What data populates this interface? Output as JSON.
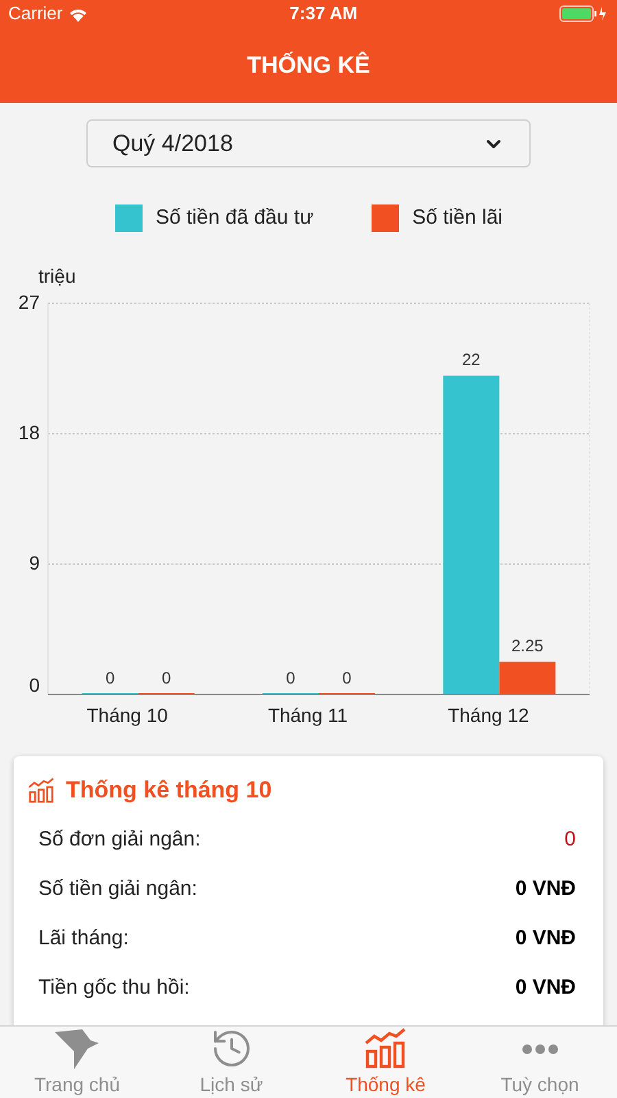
{
  "status_bar": {
    "carrier": "Carrier",
    "time": "7:37 AM"
  },
  "header": {
    "title": "THỐNG KÊ"
  },
  "period_select": {
    "value": "Quý 4/2018"
  },
  "chart_data": {
    "type": "bar",
    "ylabel": "triệu",
    "categories": [
      "Tháng 10",
      "Tháng 11",
      "Tháng 12"
    ],
    "series": [
      {
        "name": "Số tiền đã đầu tư",
        "color": "#35c3d0",
        "values": [
          0,
          0,
          22
        ]
      },
      {
        "name": "Số tiền lãi",
        "color": "#f05022",
        "values": [
          0,
          0,
          2.25
        ]
      }
    ],
    "ylim": [
      0,
      27
    ],
    "yticks": [
      0,
      9,
      18,
      27
    ],
    "data_labels": true
  },
  "summary": {
    "title": "Thống kê tháng 10",
    "rows": [
      {
        "label": "Số đơn giải ngân:",
        "value": "0",
        "kind": "count"
      },
      {
        "label": "Số tiền giải ngân:",
        "value": "0 VNĐ",
        "kind": "amount"
      },
      {
        "label": "Lãi tháng:",
        "value": "0 VNĐ",
        "kind": "amount"
      },
      {
        "label": "Tiền gốc thu hồi:",
        "value": "0 VNĐ",
        "kind": "amount"
      }
    ]
  },
  "tabs": [
    {
      "label": "Trang chủ",
      "selected": false
    },
    {
      "label": "Lịch sử",
      "selected": false
    },
    {
      "label": "Thống kê",
      "selected": true
    },
    {
      "label": "Tuỳ chọn",
      "selected": false
    }
  ]
}
